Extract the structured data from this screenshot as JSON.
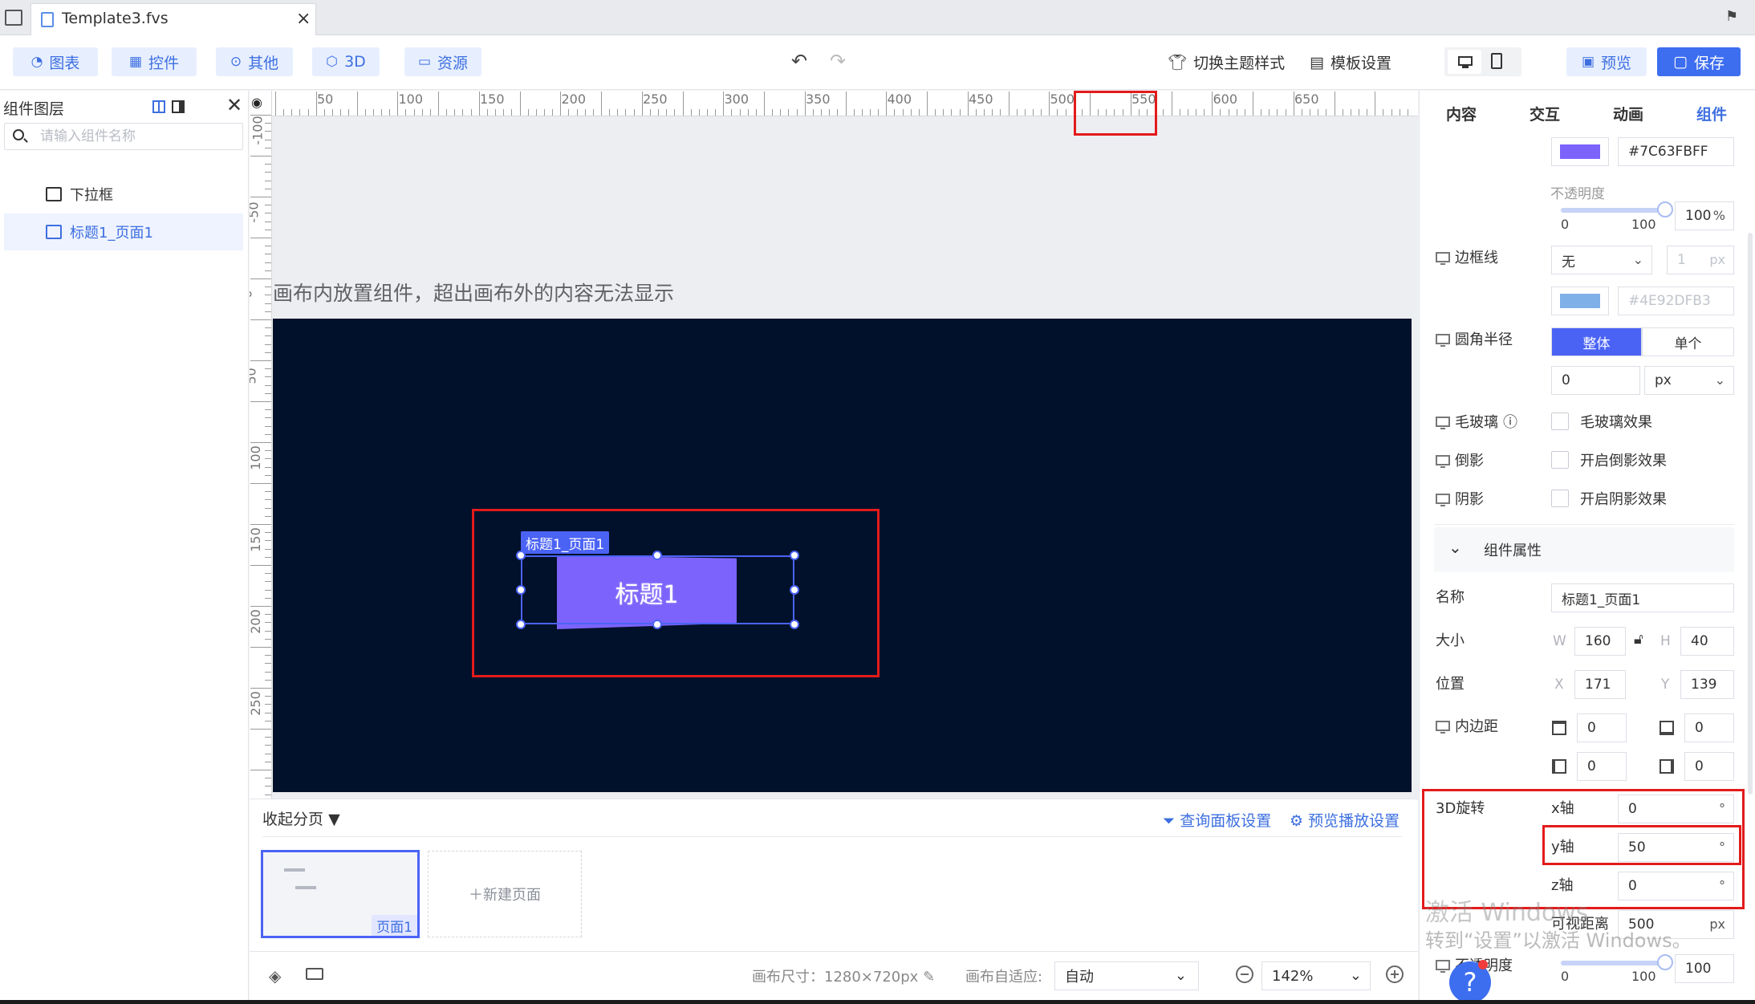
{
  "window": {
    "tab_title": "Template3.fvs"
  },
  "toolbar": {
    "chart": "图表",
    "widget": "控件",
    "other": "其他",
    "threed": "3D",
    "resource": "资源",
    "switch_theme": "切换主题样式",
    "template_settings": "模板设置",
    "preview": "预览",
    "save": "保存"
  },
  "layers": {
    "title": "组件图层",
    "search_placeholder": "请输入组件名称",
    "items": [
      {
        "label": "下拉框"
      },
      {
        "label": "标题1_页面1"
      }
    ]
  },
  "ruler": {
    "top": [
      "50",
      "100",
      "150",
      "200",
      "250",
      "300",
      "350",
      "400",
      "450",
      "500",
      "550",
      "600",
      "650"
    ],
    "left": [
      "-100",
      "-50",
      "0",
      "50",
      "100",
      "150",
      "200",
      "250"
    ]
  },
  "canvas": {
    "hint": "画布内放置组件，超出画布外的内容无法显示",
    "component_label": "标题1_页面1",
    "component_text": "标题1",
    "component_color": "#7C63FB",
    "background_color": "#02112B"
  },
  "pages": {
    "collapse": "收起分页",
    "query_panel": "查询面板设置",
    "preview_play": "预览播放设置",
    "page_name": "页面1",
    "new_page": "新建页面"
  },
  "statusbar": {
    "canvas_size": "画布尺寸：1280×720px",
    "fit_label": "画布自适应:",
    "fit_value": "自动",
    "zoom": "142%"
  },
  "props": {
    "tabs": [
      "内容",
      "交互",
      "动画",
      "组件"
    ],
    "active_tab": "组件",
    "fill_hex": "#7C63FBFF",
    "opacity_label": "不透明度",
    "opacity_min": "0",
    "opacity_max": "100",
    "opacity_value": "100",
    "opacity_unit": "%",
    "border_label": "边框线",
    "border_style": "无",
    "border_width": "1",
    "border_unit": "px",
    "border_hex": "#4E92DFB3",
    "border_color": "#7FB0E8",
    "radius_label": "圆角半径",
    "radius_whole": "整体",
    "radius_single": "单个",
    "radius_value": "0",
    "radius_unit": "px",
    "frosted_label": "毛玻璃",
    "frosted_check": "毛玻璃效果",
    "reflect_label": "倒影",
    "reflect_check": "开启倒影效果",
    "shadow_label": "阴影",
    "shadow_check": "开启阴影效果",
    "section_title": "组件属性",
    "name_label": "名称",
    "name_value": "标题1_页面1",
    "size_label": "大小",
    "w_label": "W",
    "w_value": "160",
    "h_label": "H",
    "h_value": "40",
    "pos_label": "位置",
    "x_label": "X",
    "x_value": "171",
    "y_label": "Y",
    "y_value": "139",
    "padding_label": "内边距",
    "pad_top": "0",
    "pad_bottom": "0",
    "pad_left": "0",
    "pad_right": "0",
    "rotate_label": "3D旋转",
    "rx_label": "x轴",
    "rx_value": "0",
    "ry_label": "y轴",
    "ry_value": "50",
    "rz_label": "z轴",
    "rz_value": "0",
    "deg": "°",
    "perspective_label": "可视距离",
    "perspective_value": "500",
    "perspective_unit": "px",
    "opacity2_label": "不透明度",
    "opacity2_min": "0",
    "opacity2_max": "100",
    "opacity2_value": "100"
  },
  "watermark": {
    "line1": "激活 Windows",
    "line2": "转到“设置”以激活 Windows。"
  }
}
